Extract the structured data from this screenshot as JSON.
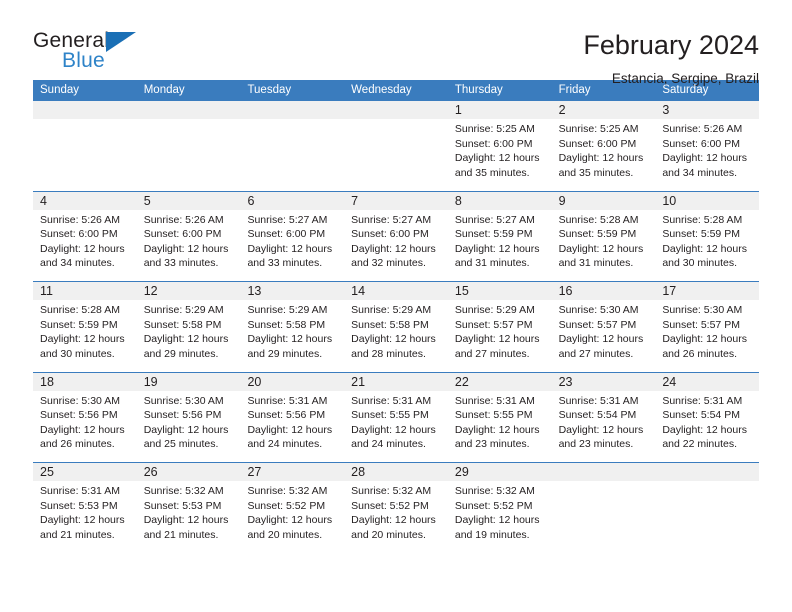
{
  "brand": {
    "name_part1": "General",
    "name_part2": "Blue",
    "triangle_icon": "triangle-icon",
    "accent_color": "#1a6fb5",
    "blue_text_color": "#2e83c8"
  },
  "header": {
    "month_title": "February 2024",
    "location": "Estancia, Sergipe, Brazil"
  },
  "calendar": {
    "header_bg_color": "#3a7cbe",
    "day_band_color": "#f0f0f0",
    "weekdays": [
      "Sunday",
      "Monday",
      "Tuesday",
      "Wednesday",
      "Thursday",
      "Friday",
      "Saturday"
    ],
    "weeks": [
      [
        {
          "day": "",
          "lines": []
        },
        {
          "day": "",
          "lines": []
        },
        {
          "day": "",
          "lines": []
        },
        {
          "day": "",
          "lines": []
        },
        {
          "day": "1",
          "lines": [
            "Sunrise: 5:25 AM",
            "Sunset: 6:00 PM",
            "Daylight: 12 hours",
            "and 35 minutes."
          ]
        },
        {
          "day": "2",
          "lines": [
            "Sunrise: 5:25 AM",
            "Sunset: 6:00 PM",
            "Daylight: 12 hours",
            "and 35 minutes."
          ]
        },
        {
          "day": "3",
          "lines": [
            "Sunrise: 5:26 AM",
            "Sunset: 6:00 PM",
            "Daylight: 12 hours",
            "and 34 minutes."
          ]
        }
      ],
      [
        {
          "day": "4",
          "lines": [
            "Sunrise: 5:26 AM",
            "Sunset: 6:00 PM",
            "Daylight: 12 hours",
            "and 34 minutes."
          ]
        },
        {
          "day": "5",
          "lines": [
            "Sunrise: 5:26 AM",
            "Sunset: 6:00 PM",
            "Daylight: 12 hours",
            "and 33 minutes."
          ]
        },
        {
          "day": "6",
          "lines": [
            "Sunrise: 5:27 AM",
            "Sunset: 6:00 PM",
            "Daylight: 12 hours",
            "and 33 minutes."
          ]
        },
        {
          "day": "7",
          "lines": [
            "Sunrise: 5:27 AM",
            "Sunset: 6:00 PM",
            "Daylight: 12 hours",
            "and 32 minutes."
          ]
        },
        {
          "day": "8",
          "lines": [
            "Sunrise: 5:27 AM",
            "Sunset: 5:59 PM",
            "Daylight: 12 hours",
            "and 31 minutes."
          ]
        },
        {
          "day": "9",
          "lines": [
            "Sunrise: 5:28 AM",
            "Sunset: 5:59 PM",
            "Daylight: 12 hours",
            "and 31 minutes."
          ]
        },
        {
          "day": "10",
          "lines": [
            "Sunrise: 5:28 AM",
            "Sunset: 5:59 PM",
            "Daylight: 12 hours",
            "and 30 minutes."
          ]
        }
      ],
      [
        {
          "day": "11",
          "lines": [
            "Sunrise: 5:28 AM",
            "Sunset: 5:59 PM",
            "Daylight: 12 hours",
            "and 30 minutes."
          ]
        },
        {
          "day": "12",
          "lines": [
            "Sunrise: 5:29 AM",
            "Sunset: 5:58 PM",
            "Daylight: 12 hours",
            "and 29 minutes."
          ]
        },
        {
          "day": "13",
          "lines": [
            "Sunrise: 5:29 AM",
            "Sunset: 5:58 PM",
            "Daylight: 12 hours",
            "and 29 minutes."
          ]
        },
        {
          "day": "14",
          "lines": [
            "Sunrise: 5:29 AM",
            "Sunset: 5:58 PM",
            "Daylight: 12 hours",
            "and 28 minutes."
          ]
        },
        {
          "day": "15",
          "lines": [
            "Sunrise: 5:29 AM",
            "Sunset: 5:57 PM",
            "Daylight: 12 hours",
            "and 27 minutes."
          ]
        },
        {
          "day": "16",
          "lines": [
            "Sunrise: 5:30 AM",
            "Sunset: 5:57 PM",
            "Daylight: 12 hours",
            "and 27 minutes."
          ]
        },
        {
          "day": "17",
          "lines": [
            "Sunrise: 5:30 AM",
            "Sunset: 5:57 PM",
            "Daylight: 12 hours",
            "and 26 minutes."
          ]
        }
      ],
      [
        {
          "day": "18",
          "lines": [
            "Sunrise: 5:30 AM",
            "Sunset: 5:56 PM",
            "Daylight: 12 hours",
            "and 26 minutes."
          ]
        },
        {
          "day": "19",
          "lines": [
            "Sunrise: 5:30 AM",
            "Sunset: 5:56 PM",
            "Daylight: 12 hours",
            "and 25 minutes."
          ]
        },
        {
          "day": "20",
          "lines": [
            "Sunrise: 5:31 AM",
            "Sunset: 5:56 PM",
            "Daylight: 12 hours",
            "and 24 minutes."
          ]
        },
        {
          "day": "21",
          "lines": [
            "Sunrise: 5:31 AM",
            "Sunset: 5:55 PM",
            "Daylight: 12 hours",
            "and 24 minutes."
          ]
        },
        {
          "day": "22",
          "lines": [
            "Sunrise: 5:31 AM",
            "Sunset: 5:55 PM",
            "Daylight: 12 hours",
            "and 23 minutes."
          ]
        },
        {
          "day": "23",
          "lines": [
            "Sunrise: 5:31 AM",
            "Sunset: 5:54 PM",
            "Daylight: 12 hours",
            "and 23 minutes."
          ]
        },
        {
          "day": "24",
          "lines": [
            "Sunrise: 5:31 AM",
            "Sunset: 5:54 PM",
            "Daylight: 12 hours",
            "and 22 minutes."
          ]
        }
      ],
      [
        {
          "day": "25",
          "lines": [
            "Sunrise: 5:31 AM",
            "Sunset: 5:53 PM",
            "Daylight: 12 hours",
            "and 21 minutes."
          ]
        },
        {
          "day": "26",
          "lines": [
            "Sunrise: 5:32 AM",
            "Sunset: 5:53 PM",
            "Daylight: 12 hours",
            "and 21 minutes."
          ]
        },
        {
          "day": "27",
          "lines": [
            "Sunrise: 5:32 AM",
            "Sunset: 5:52 PM",
            "Daylight: 12 hours",
            "and 20 minutes."
          ]
        },
        {
          "day": "28",
          "lines": [
            "Sunrise: 5:32 AM",
            "Sunset: 5:52 PM",
            "Daylight: 12 hours",
            "and 20 minutes."
          ]
        },
        {
          "day": "29",
          "lines": [
            "Sunrise: 5:32 AM",
            "Sunset: 5:52 PM",
            "Daylight: 12 hours",
            "and 19 minutes."
          ]
        },
        {
          "day": "",
          "lines": []
        },
        {
          "day": "",
          "lines": []
        }
      ]
    ]
  }
}
